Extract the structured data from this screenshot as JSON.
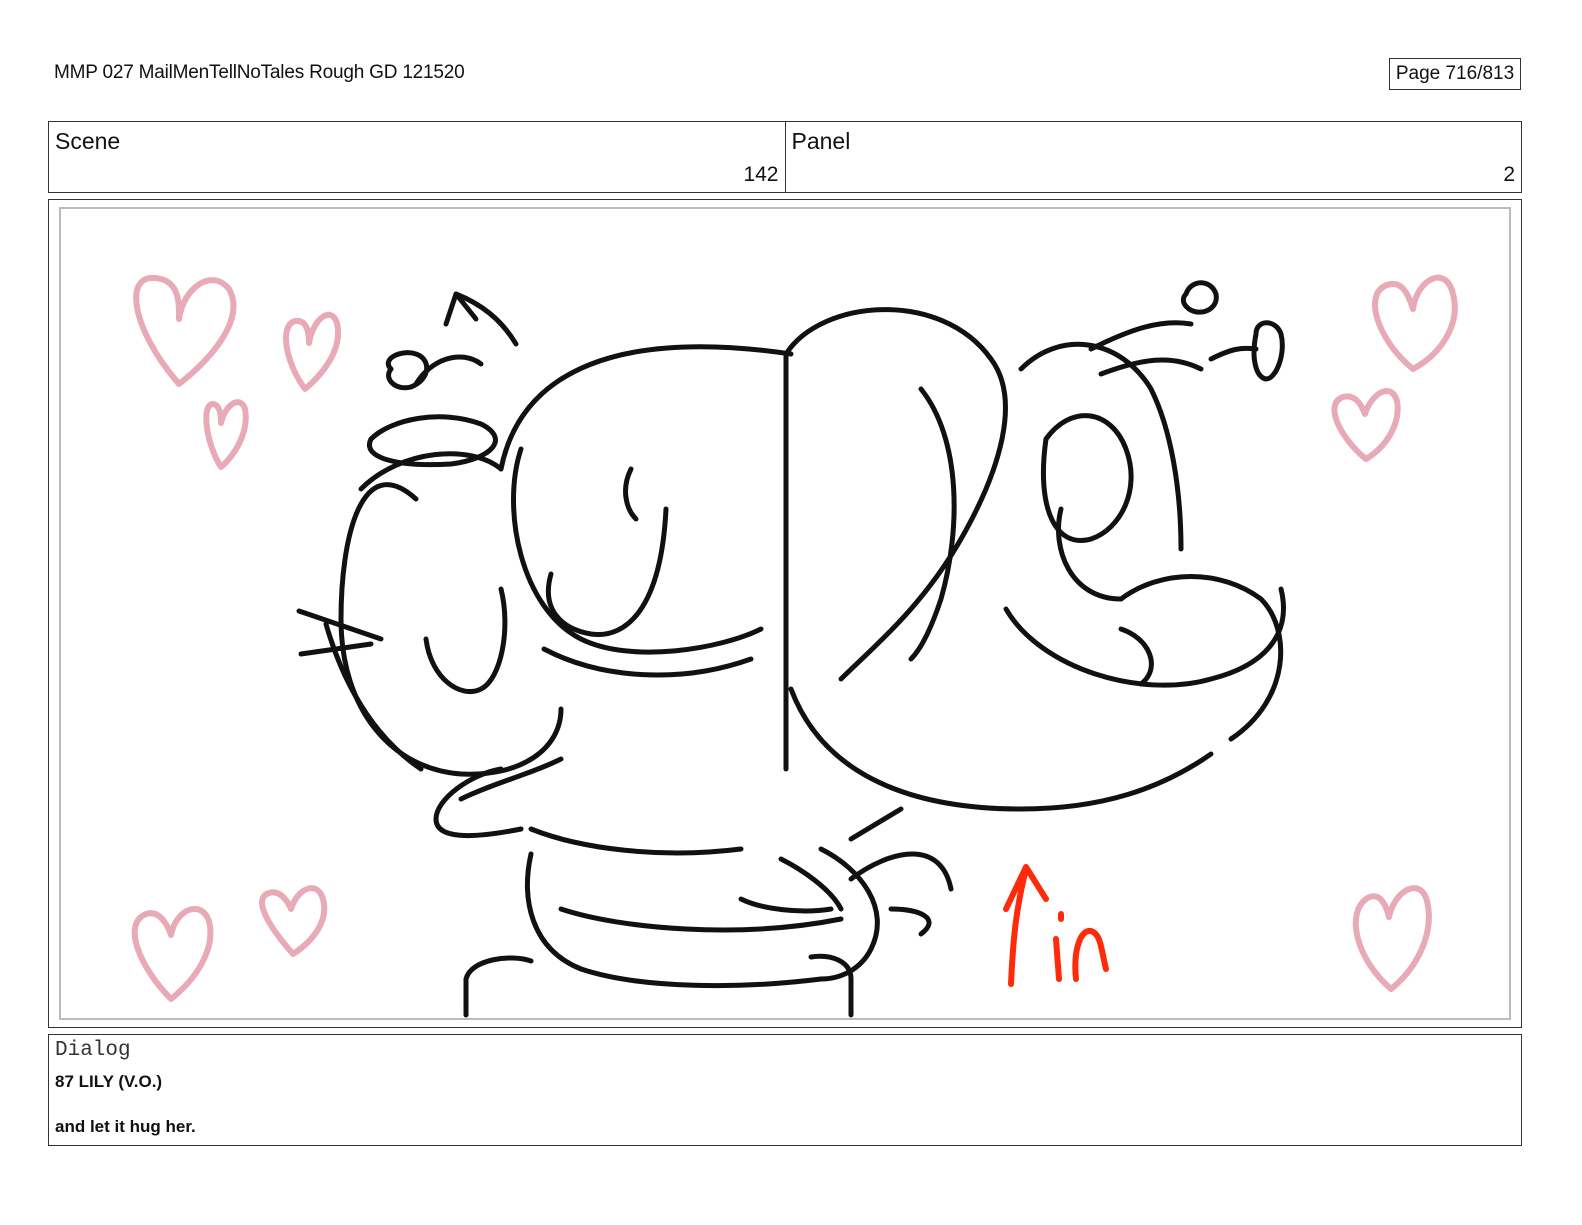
{
  "header": {
    "doc_title": "MMP 027 MailMenTellNoTales Rough GD 121520",
    "page": "Page 716/813"
  },
  "meta": {
    "scene_label": "Scene",
    "scene_value": "142",
    "panel_label": "Panel",
    "panel_value": "2"
  },
  "dialog": {
    "label": "Dialog",
    "speaker": "87 LILY (V.O.)",
    "line": "and let it hug her."
  },
  "colors": {
    "sketch_ink": "#111111",
    "heart_pink": "#e8aab7",
    "arrow_red": "#ff2a0a"
  }
}
